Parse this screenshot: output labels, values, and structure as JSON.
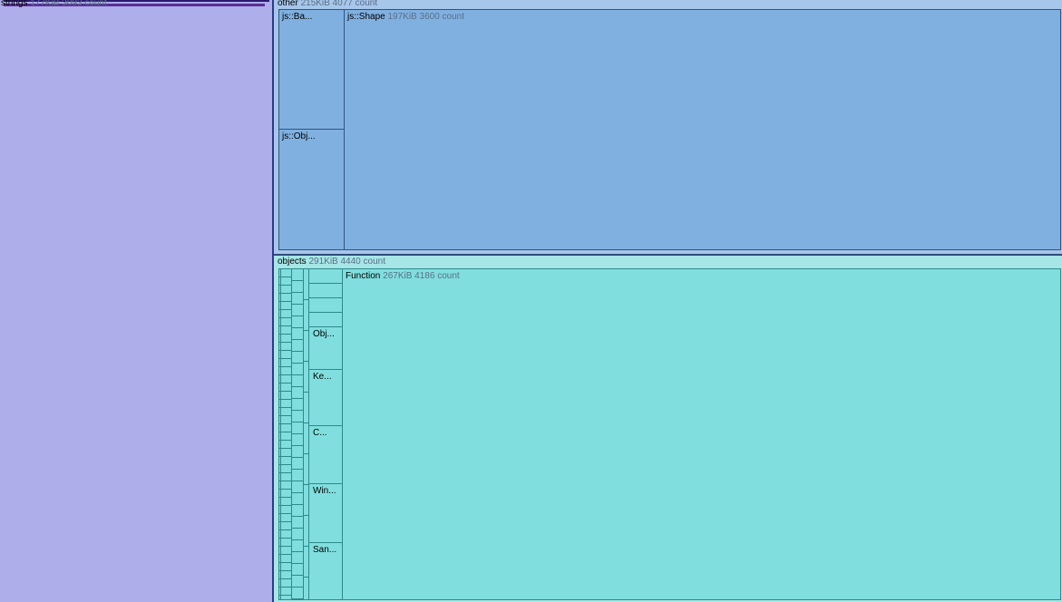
{
  "strings": {
    "name": "strings",
    "stats": "177KiB 3093 count"
  },
  "other": {
    "name": "other",
    "stats": "215KiB 4077 count",
    "children": [
      {
        "label": "js::Ba..."
      },
      {
        "label": "js::Obj..."
      },
      {
        "label": "js::Shape",
        "stats": "197KiB 3600 count"
      }
    ]
  },
  "objects": {
    "name": "objects",
    "stats": "291KiB 4440 count",
    "children": [
      {
        "label": "Obj..."
      },
      {
        "label": "Ke..."
      },
      {
        "label": "C..."
      },
      {
        "label": "Win..."
      },
      {
        "label": "San..."
      },
      {
        "label": "Function",
        "stats": "267KiB 4186 count"
      }
    ]
  },
  "colors": {
    "strings": "#aeaeea",
    "other": "#80b0e0",
    "objects": "#80dede"
  }
}
